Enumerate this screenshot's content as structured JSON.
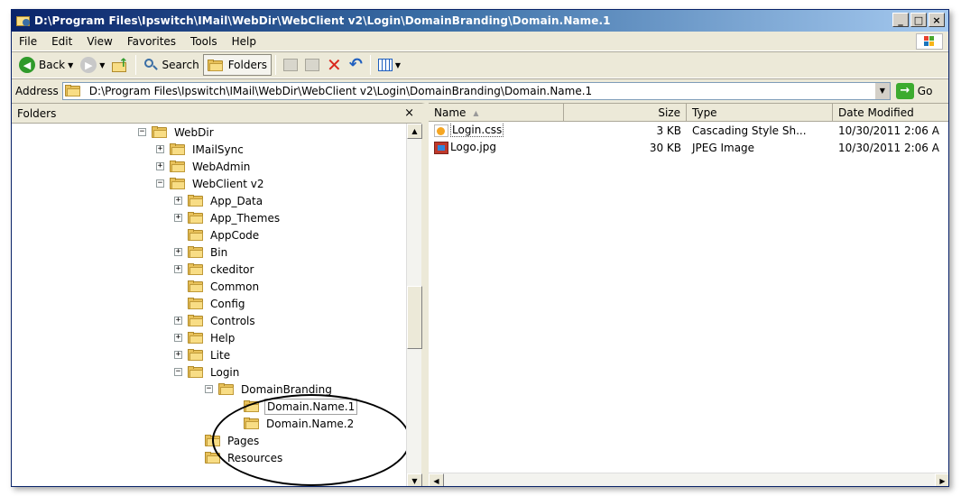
{
  "window": {
    "title": "D:\\Program Files\\Ipswitch\\IMail\\WebDir\\WebClient v2\\Login\\DomainBranding\\Domain.Name.1",
    "minimize": "_",
    "maximize": "□",
    "close": "×"
  },
  "menu": {
    "file": "File",
    "edit": "Edit",
    "view": "View",
    "favorites": "Favorites",
    "tools": "Tools",
    "help": "Help"
  },
  "toolbar": {
    "back": "Back",
    "search": "Search",
    "folders": "Folders"
  },
  "address": {
    "label": "Address",
    "value": "D:\\Program Files\\Ipswitch\\IMail\\WebDir\\WebClient v2\\Login\\DomainBranding\\Domain.Name.1",
    "go": "Go"
  },
  "folders": {
    "header": "Folders",
    "close": "×",
    "items": [
      {
        "label": "WebDir",
        "expander": "−"
      },
      {
        "label": "IMailSync",
        "expander": "+"
      },
      {
        "label": "WebAdmin",
        "expander": "+"
      },
      {
        "label": "WebClient v2",
        "expander": "−"
      },
      {
        "label": "App_Data",
        "expander": "+"
      },
      {
        "label": "App_Themes",
        "expander": "+"
      },
      {
        "label": "AppCode",
        "expander": ""
      },
      {
        "label": "Bin",
        "expander": "+"
      },
      {
        "label": "ckeditor",
        "expander": "+"
      },
      {
        "label": "Common",
        "expander": ""
      },
      {
        "label": "Config",
        "expander": ""
      },
      {
        "label": "Controls",
        "expander": "+"
      },
      {
        "label": "Help",
        "expander": "+"
      },
      {
        "label": "Lite",
        "expander": "+"
      },
      {
        "label": "Login",
        "expander": "−"
      },
      {
        "label": "DomainBranding",
        "expander": "−"
      },
      {
        "label": "Domain.Name.1",
        "expander": ""
      },
      {
        "label": "Domain.Name.2",
        "expander": ""
      },
      {
        "label": "Pages",
        "expander": ""
      },
      {
        "label": "Resources",
        "expander": ""
      }
    ]
  },
  "files": {
    "columns": {
      "name": "Name",
      "size": "Size",
      "type": "Type",
      "date": "Date Modified"
    },
    "rows": [
      {
        "name": "Login.css",
        "size": "3 KB",
        "type": "Cascading Style Sh...",
        "date": "10/30/2011 2:06 A",
        "icon": "css-file-icon"
      },
      {
        "name": "Logo.jpg",
        "size": "30 KB",
        "type": "JPEG Image",
        "date": "10/30/2011 2:06 A",
        "icon": "jpeg-file-icon"
      }
    ]
  },
  "colors": {
    "titlebar": "#0a246a",
    "chrome": "#ece9d8",
    "folder": "#e8c15a"
  }
}
